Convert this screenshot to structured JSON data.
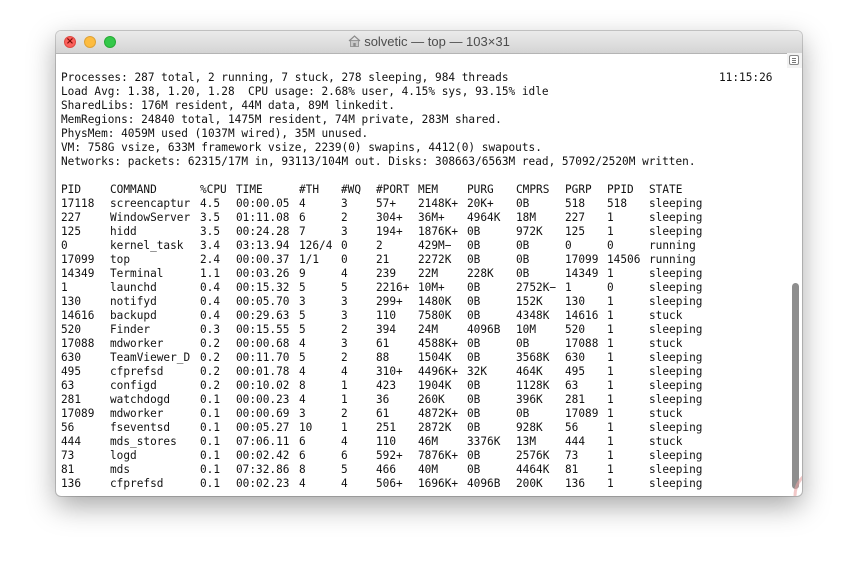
{
  "window": {
    "title": "solvetic — top — 103×31"
  },
  "summary": {
    "processes": "Processes: 287 total, 2 running, 7 stuck, 278 sleeping, 984 threads",
    "time": "11:15:26",
    "load": "Load Avg: 1.38, 1.20, 1.28  CPU usage: 2.68% user, 4.15% sys, 93.15% idle",
    "sharedlibs": "SharedLibs: 176M resident, 44M data, 89M linkedit.",
    "memregions": "MemRegions: 24840 total, 1475M resident, 74M private, 283M shared.",
    "physmem": "PhysMem: 4059M used (1037M wired), 35M unused.",
    "vm": "VM: 758G vsize, 633M framework vsize, 2239(0) swapins, 4412(0) swapouts.",
    "networks": "Networks: packets: 62315/17M in, 93113/104M out. Disks: 308663/6563M read, 57092/2520M written."
  },
  "table": {
    "headers": [
      "PID",
      "COMMAND",
      "%CPU",
      "TIME",
      "#TH",
      "#WQ",
      "#PORT",
      "MEM",
      "PURG",
      "CMPRS",
      "PGRP",
      "PPID",
      "STATE"
    ],
    "rows": [
      [
        "17118",
        "screencaptur",
        "4.5",
        "00:00.05",
        "4",
        "3",
        "57+",
        "2148K+",
        "20K+",
        "0B",
        "518",
        "518",
        "sleeping"
      ],
      [
        "227",
        "WindowServer",
        "3.5",
        "01:11.08",
        "6",
        "2",
        "304+",
        "36M+",
        "4964K",
        "18M",
        "227",
        "1",
        "sleeping"
      ],
      [
        "125",
        "hidd",
        "3.5",
        "00:24.28",
        "7",
        "3",
        "194+",
        "1876K+",
        "0B",
        "972K",
        "125",
        "1",
        "sleeping"
      ],
      [
        "0",
        "kernel_task",
        "3.4",
        "03:13.94",
        "126/4",
        "0",
        "2",
        "429M−",
        "0B",
        "0B",
        "0",
        "0",
        "running"
      ],
      [
        "17099",
        "top",
        "2.4",
        "00:00.37",
        "1/1",
        "0",
        "21",
        "2272K",
        "0B",
        "0B",
        "17099",
        "14506",
        "running"
      ],
      [
        "14349",
        "Terminal",
        "1.1",
        "00:03.26",
        "9",
        "4",
        "239",
        "22M",
        "228K",
        "0B",
        "14349",
        "1",
        "sleeping"
      ],
      [
        "1",
        "launchd",
        "0.4",
        "00:15.32",
        "5",
        "5",
        "2216+",
        "10M+",
        "0B",
        "2752K−",
        "1",
        "0",
        "sleeping"
      ],
      [
        "130",
        "notifyd",
        "0.4",
        "00:05.70",
        "3",
        "3",
        "299+",
        "1480K",
        "0B",
        "152K",
        "130",
        "1",
        "sleeping"
      ],
      [
        "14616",
        "backupd",
        "0.4",
        "00:29.63",
        "5",
        "3",
        "110",
        "7580K",
        "0B",
        "4348K",
        "14616",
        "1",
        "stuck"
      ],
      [
        "520",
        "Finder",
        "0.3",
        "00:15.55",
        "5",
        "2",
        "394",
        "24M",
        "4096B",
        "10M",
        "520",
        "1",
        "sleeping"
      ],
      [
        "17088",
        "mdworker",
        "0.2",
        "00:00.68",
        "4",
        "3",
        "61",
        "4588K+",
        "0B",
        "0B",
        "17088",
        "1",
        "stuck"
      ],
      [
        "630",
        "TeamViewer_D",
        "0.2",
        "00:11.70",
        "5",
        "2",
        "88",
        "1504K",
        "0B",
        "3568K",
        "630",
        "1",
        "sleeping"
      ],
      [
        "495",
        "cfprefsd",
        "0.2",
        "00:01.78",
        "4",
        "4",
        "310+",
        "4496K+",
        "32K",
        "464K",
        "495",
        "1",
        "sleeping"
      ],
      [
        "63",
        "configd",
        "0.2",
        "00:10.02",
        "8",
        "1",
        "423",
        "1904K",
        "0B",
        "1128K",
        "63",
        "1",
        "sleeping"
      ],
      [
        "281",
        "watchdogd",
        "0.1",
        "00:00.23",
        "4",
        "1",
        "36",
        "260K",
        "0B",
        "396K",
        "281",
        "1",
        "sleeping"
      ],
      [
        "17089",
        "mdworker",
        "0.1",
        "00:00.69",
        "3",
        "2",
        "61",
        "4872K+",
        "0B",
        "0B",
        "17089",
        "1",
        "stuck"
      ],
      [
        "56",
        "fseventsd",
        "0.1",
        "00:05.27",
        "10",
        "1",
        "251",
        "2872K",
        "0B",
        "928K",
        "56",
        "1",
        "sleeping"
      ],
      [
        "444",
        "mds_stores",
        "0.1",
        "07:06.11",
        "6",
        "4",
        "110",
        "46M",
        "3376K",
        "13M",
        "444",
        "1",
        "stuck"
      ],
      [
        "73",
        "logd",
        "0.1",
        "00:02.42",
        "6",
        "6",
        "592+",
        "7876K+",
        "0B",
        "2576K",
        "73",
        "1",
        "sleeping"
      ],
      [
        "81",
        "mds",
        "0.1",
        "07:32.86",
        "8",
        "5",
        "466",
        "40M",
        "0B",
        "4464K",
        "81",
        "1",
        "sleeping"
      ],
      [
        "136",
        "cfprefsd",
        "0.1",
        "00:02.23",
        "4",
        "4",
        "506+",
        "1696K+",
        "4096B",
        "200K",
        "136",
        "1",
        "sleeping"
      ]
    ]
  },
  "icons": {
    "title_icon": "home-folder-icon",
    "scroll_icon": "terminal-scroll-icon",
    "watermark": "solvetic-logo"
  },
  "colors": {
    "close": "#fc605c",
    "minimize": "#fdbc40",
    "maximize": "#34c84a",
    "text": "#111111",
    "watermark": "#e8a3a3"
  }
}
